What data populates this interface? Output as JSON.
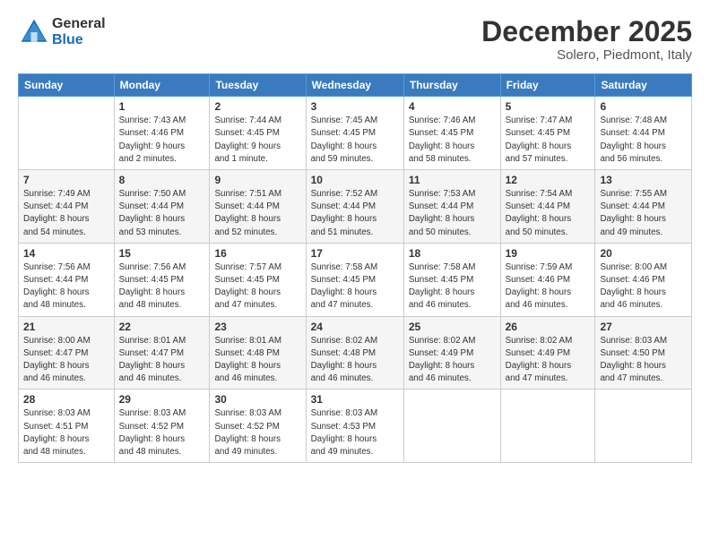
{
  "logo": {
    "general": "General",
    "blue": "Blue"
  },
  "title": {
    "month_year": "December 2025",
    "location": "Solero, Piedmont, Italy"
  },
  "days_of_week": [
    "Sunday",
    "Monday",
    "Tuesday",
    "Wednesday",
    "Thursday",
    "Friday",
    "Saturday"
  ],
  "weeks": [
    [
      {
        "day": "",
        "info": ""
      },
      {
        "day": "1",
        "info": "Sunrise: 7:43 AM\nSunset: 4:46 PM\nDaylight: 9 hours\nand 2 minutes."
      },
      {
        "day": "2",
        "info": "Sunrise: 7:44 AM\nSunset: 4:45 PM\nDaylight: 9 hours\nand 1 minute."
      },
      {
        "day": "3",
        "info": "Sunrise: 7:45 AM\nSunset: 4:45 PM\nDaylight: 8 hours\nand 59 minutes."
      },
      {
        "day": "4",
        "info": "Sunrise: 7:46 AM\nSunset: 4:45 PM\nDaylight: 8 hours\nand 58 minutes."
      },
      {
        "day": "5",
        "info": "Sunrise: 7:47 AM\nSunset: 4:45 PM\nDaylight: 8 hours\nand 57 minutes."
      },
      {
        "day": "6",
        "info": "Sunrise: 7:48 AM\nSunset: 4:44 PM\nDaylight: 8 hours\nand 56 minutes."
      }
    ],
    [
      {
        "day": "7",
        "info": "Sunrise: 7:49 AM\nSunset: 4:44 PM\nDaylight: 8 hours\nand 54 minutes."
      },
      {
        "day": "8",
        "info": "Sunrise: 7:50 AM\nSunset: 4:44 PM\nDaylight: 8 hours\nand 53 minutes."
      },
      {
        "day": "9",
        "info": "Sunrise: 7:51 AM\nSunset: 4:44 PM\nDaylight: 8 hours\nand 52 minutes."
      },
      {
        "day": "10",
        "info": "Sunrise: 7:52 AM\nSunset: 4:44 PM\nDaylight: 8 hours\nand 51 minutes."
      },
      {
        "day": "11",
        "info": "Sunrise: 7:53 AM\nSunset: 4:44 PM\nDaylight: 8 hours\nand 50 minutes."
      },
      {
        "day": "12",
        "info": "Sunrise: 7:54 AM\nSunset: 4:44 PM\nDaylight: 8 hours\nand 50 minutes."
      },
      {
        "day": "13",
        "info": "Sunrise: 7:55 AM\nSunset: 4:44 PM\nDaylight: 8 hours\nand 49 minutes."
      }
    ],
    [
      {
        "day": "14",
        "info": "Sunrise: 7:56 AM\nSunset: 4:44 PM\nDaylight: 8 hours\nand 48 minutes."
      },
      {
        "day": "15",
        "info": "Sunrise: 7:56 AM\nSunset: 4:45 PM\nDaylight: 8 hours\nand 48 minutes."
      },
      {
        "day": "16",
        "info": "Sunrise: 7:57 AM\nSunset: 4:45 PM\nDaylight: 8 hours\nand 47 minutes."
      },
      {
        "day": "17",
        "info": "Sunrise: 7:58 AM\nSunset: 4:45 PM\nDaylight: 8 hours\nand 47 minutes."
      },
      {
        "day": "18",
        "info": "Sunrise: 7:58 AM\nSunset: 4:45 PM\nDaylight: 8 hours\nand 46 minutes."
      },
      {
        "day": "19",
        "info": "Sunrise: 7:59 AM\nSunset: 4:46 PM\nDaylight: 8 hours\nand 46 minutes."
      },
      {
        "day": "20",
        "info": "Sunrise: 8:00 AM\nSunset: 4:46 PM\nDaylight: 8 hours\nand 46 minutes."
      }
    ],
    [
      {
        "day": "21",
        "info": "Sunrise: 8:00 AM\nSunset: 4:47 PM\nDaylight: 8 hours\nand 46 minutes."
      },
      {
        "day": "22",
        "info": "Sunrise: 8:01 AM\nSunset: 4:47 PM\nDaylight: 8 hours\nand 46 minutes."
      },
      {
        "day": "23",
        "info": "Sunrise: 8:01 AM\nSunset: 4:48 PM\nDaylight: 8 hours\nand 46 minutes."
      },
      {
        "day": "24",
        "info": "Sunrise: 8:02 AM\nSunset: 4:48 PM\nDaylight: 8 hours\nand 46 minutes."
      },
      {
        "day": "25",
        "info": "Sunrise: 8:02 AM\nSunset: 4:49 PM\nDaylight: 8 hours\nand 46 minutes."
      },
      {
        "day": "26",
        "info": "Sunrise: 8:02 AM\nSunset: 4:49 PM\nDaylight: 8 hours\nand 47 minutes."
      },
      {
        "day": "27",
        "info": "Sunrise: 8:03 AM\nSunset: 4:50 PM\nDaylight: 8 hours\nand 47 minutes."
      }
    ],
    [
      {
        "day": "28",
        "info": "Sunrise: 8:03 AM\nSunset: 4:51 PM\nDaylight: 8 hours\nand 48 minutes."
      },
      {
        "day": "29",
        "info": "Sunrise: 8:03 AM\nSunset: 4:52 PM\nDaylight: 8 hours\nand 48 minutes."
      },
      {
        "day": "30",
        "info": "Sunrise: 8:03 AM\nSunset: 4:52 PM\nDaylight: 8 hours\nand 49 minutes."
      },
      {
        "day": "31",
        "info": "Sunrise: 8:03 AM\nSunset: 4:53 PM\nDaylight: 8 hours\nand 49 minutes."
      },
      {
        "day": "",
        "info": ""
      },
      {
        "day": "",
        "info": ""
      },
      {
        "day": "",
        "info": ""
      }
    ]
  ]
}
